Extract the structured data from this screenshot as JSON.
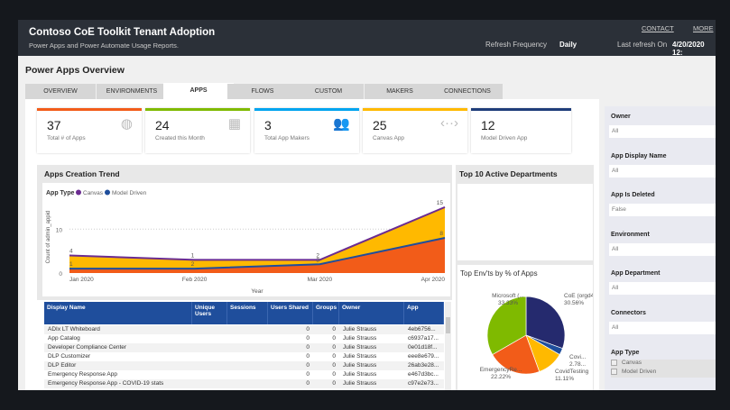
{
  "header": {
    "title": "Contoso CoE Toolkit Tenant Adoption",
    "subtitle": "Power Apps and Power Automate Usage Reports.",
    "contact": "CONTACT",
    "more": "MORE",
    "refresh_label": "Refresh Frequency",
    "refresh_value": "Daily",
    "last_refresh_label": "Last refresh On",
    "last_refresh_value": "4/20/2020 12:"
  },
  "page_title": "Power Apps Overview",
  "tabs": [
    {
      "label": "OVERVIEW"
    },
    {
      "label": "ENVIRONMENTS"
    },
    {
      "label": "APPS",
      "active": true
    },
    {
      "label": "FLOWS"
    },
    {
      "label": "CUSTOM CONNECTORS"
    },
    {
      "label": "MAKERS"
    },
    {
      "label": "CONNECTIONS"
    }
  ],
  "kpis": [
    {
      "value": "37",
      "label": "Total # of Apps",
      "color": "#f25c19",
      "icon": "globe-icon"
    },
    {
      "value": "24",
      "label": "Created this Month",
      "color": "#7fba00",
      "icon": "calendar-icon"
    },
    {
      "value": "3",
      "label": "Total App Makers",
      "color": "#00a4ef",
      "icon": "people-icon"
    },
    {
      "value": "25",
      "label": "Canvas App",
      "color": "#ffb900",
      "icon": "code-icon"
    },
    {
      "value": "12",
      "label": "Model Driven App",
      "color": "#1f3d7a",
      "icon": ""
    }
  ],
  "trend": {
    "title": "Apps Creation Trend",
    "legend_title": "App Type"
  },
  "chart_data": [
    {
      "type": "area",
      "title": "Apps Creation Trend",
      "xlabel": "Year",
      "ylabel": "Count of admin_appid",
      "categories": [
        "Jan 2020",
        "Feb 2020",
        "Mar 2020",
        "Apr 2020"
      ],
      "yticks": [
        "0",
        "10"
      ],
      "ylim": [
        0,
        16
      ],
      "legend_placement": "top-left",
      "series": [
        {
          "name": "Canvas",
          "values": [
            4,
            3,
            3,
            15
          ],
          "line_color": "#6b2c91",
          "fill_color": "#ffb900",
          "labels": [
            "4",
            "1",
            "2",
            "15"
          ]
        },
        {
          "name": "Model Driven",
          "values": [
            1,
            1,
            2,
            8
          ],
          "line_color": "#1f4e9c",
          "fill_color": "#f25c19",
          "labels": [
            "1",
            "2",
            "3",
            "8"
          ]
        }
      ]
    },
    {
      "type": "pie",
      "title": "Top Env'ts by % of Apps",
      "slices": [
        {
          "label": "CoE (orgd4...",
          "value": 30.56,
          "text": "30.56%",
          "color": "#252a6e"
        },
        {
          "label": "Covi...",
          "value": 2.78,
          "text": "2.78...",
          "color": "#1f4e9c"
        },
        {
          "label": "CovidTesting",
          "value": 11.11,
          "text": "11.11%",
          "color": "#ffb900"
        },
        {
          "label": "EmergencyRe...",
          "value": 22.22,
          "text": "22.22%",
          "color": "#f25c19"
        },
        {
          "label": "Microsoft (...",
          "value": 33.33,
          "text": "33.33%",
          "color": "#7fba00"
        }
      ]
    }
  ],
  "top10": {
    "title": "Top 10 Active Departments"
  },
  "table": {
    "columns": [
      "Display Name",
      "Unique Users",
      "Sessions",
      "Users Shared",
      "Groups",
      "Owner",
      "App"
    ],
    "rows": [
      [
        "ADIx LT Whiteboard",
        "",
        "",
        "0",
        "0",
        "Julie Strauss",
        "4eb6756..."
      ],
      [
        "App Catalog",
        "",
        "",
        "0",
        "0",
        "Julie Strauss",
        "c6937a17..."
      ],
      [
        "Developer Compliance Center",
        "",
        "",
        "0",
        "0",
        "Julie Strauss",
        "0e01d18f..."
      ],
      [
        "DLP Customizer",
        "",
        "",
        "0",
        "0",
        "Julie Strauss",
        "eee8e679..."
      ],
      [
        "DLP Editor",
        "",
        "",
        "0",
        "0",
        "Julie Strauss",
        "26ab3e28..."
      ],
      [
        "Emergency Response App",
        "",
        "",
        "0",
        "0",
        "Julie Strauss",
        "e467d3bc..."
      ],
      [
        "Emergency Response App - COVID-19 stats",
        "",
        "",
        "0",
        "0",
        "Julie Strauss",
        "c97e2e73..."
      ]
    ]
  },
  "filters": [
    {
      "label": "Owner",
      "value": "All"
    },
    {
      "label": "App Display Name",
      "value": "All"
    },
    {
      "label": "App Is Deleted",
      "value": "False"
    },
    {
      "label": "Environment",
      "value": "All"
    },
    {
      "label": "App Department",
      "value": "All"
    },
    {
      "label": "Connectors",
      "value": "All"
    }
  ],
  "app_type_filter": {
    "label": "App Type",
    "options": [
      "Canvas",
      "Model Driven"
    ]
  }
}
